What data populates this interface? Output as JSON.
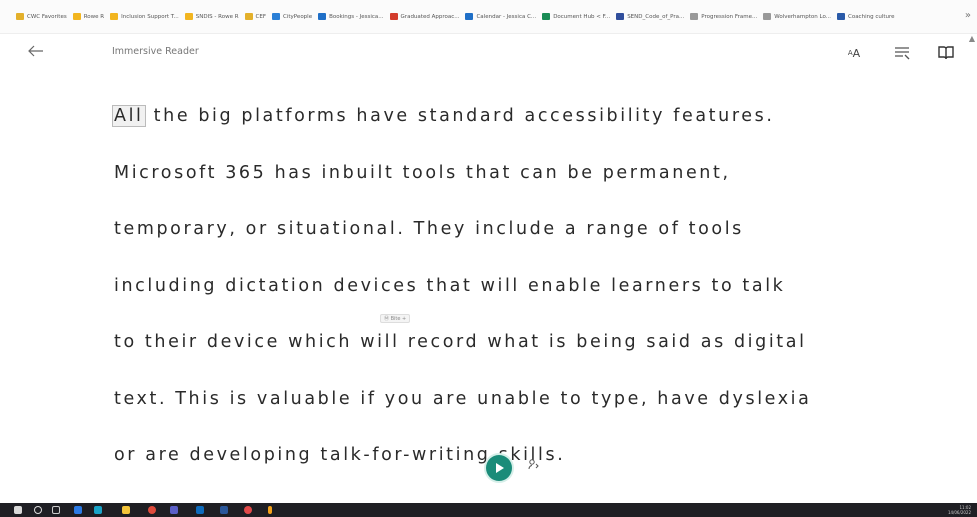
{
  "bookmarks": [
    {
      "label": "CWC Favorites",
      "color": "#e3b02b"
    },
    {
      "label": "Rowe R",
      "color": "#f2b51f"
    },
    {
      "label": "Inclusion Support T...",
      "color": "#f2b51f"
    },
    {
      "label": "SNDIS - Rowe R",
      "color": "#f2b51f"
    },
    {
      "label": "CEF",
      "color": "#e3b02b"
    },
    {
      "label": "CityPeople",
      "color": "#2a7fd6"
    },
    {
      "label": "Bookings - Jessica...",
      "color": "#1f6fc7"
    },
    {
      "label": "Graduated Approac...",
      "color": "#d33c2c"
    },
    {
      "label": "Calendar - Jessica C...",
      "color": "#1f6fc7"
    },
    {
      "label": "Document Hub < F...",
      "color": "#1a8c55"
    },
    {
      "label": "SEND_Code_of_Pra...",
      "color": "#304e9c"
    },
    {
      "label": "Progression Frame...",
      "color": "#999999"
    },
    {
      "label": "Wolverhampton Lo...",
      "color": "#999999"
    },
    {
      "label": "Coaching culture",
      "color": "#2a5aa8"
    }
  ],
  "bookmarks_overflow": "»",
  "reader": {
    "back_icon": "arrow-left-icon",
    "title": "Immersive Reader",
    "text_pref_glyph": "AA",
    "lines": [
      " the big platforms have standard accessibility features.",
      "Microsoft 365 has inbuilt tools that can be permanent,",
      "temporary, or situational. They include a range of tools",
      "including dictation devices that will enable learners to talk",
      "to their device which will record what is being said as digital",
      "text. This is valuable if you are unable to type, have dyslexia",
      "or are developing talk-for-writing skills."
    ],
    "highlighted_word": "All",
    "marker_text": "Ⓜ Bite +"
  },
  "controls": {
    "play_icon": "play-icon",
    "voice_settings_icon": "voice-settings-icon",
    "accent": "#1a8c79"
  },
  "taskbar": {
    "time": "11:02",
    "date": "14/06/2022"
  }
}
